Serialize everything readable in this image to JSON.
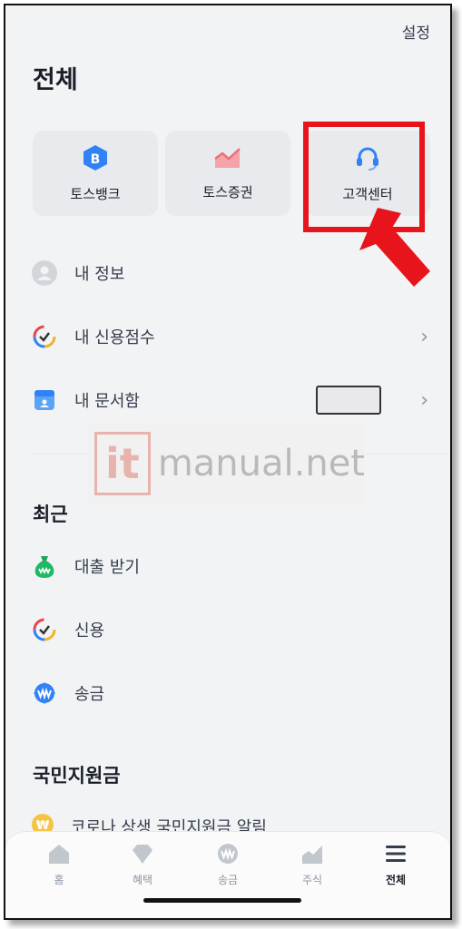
{
  "header": {
    "settings_label": "설정",
    "title": "전체"
  },
  "cards": [
    {
      "label": "토스뱅크",
      "icon": "toss-bank-icon"
    },
    {
      "label": "토스증권",
      "icon": "toss-securities-icon"
    },
    {
      "label": "고객센터",
      "icon": "headset-icon"
    }
  ],
  "menu": [
    {
      "label": "내 정보",
      "icon": "person-icon"
    },
    {
      "label": "내 신용점수",
      "icon": "credit-score-icon"
    },
    {
      "label": "내 문서함",
      "icon": "document-box-icon"
    }
  ],
  "watermark": {
    "mark": "it",
    "text": "manual.net"
  },
  "recent": {
    "title": "최근",
    "items": [
      {
        "label": "대출 받기",
        "icon": "money-bag-icon"
      },
      {
        "label": "신용",
        "icon": "credit-score-icon"
      },
      {
        "label": "송금",
        "icon": "transfer-icon"
      }
    ]
  },
  "support": {
    "title": "국민지원금",
    "items": [
      {
        "label": "코로나 상생 국민지원금 알림",
        "icon": "coin-icon"
      }
    ]
  },
  "tabs": [
    {
      "label": "홈",
      "icon": "home-icon",
      "active": false
    },
    {
      "label": "혜택",
      "icon": "benefit-icon",
      "active": false
    },
    {
      "label": "송금",
      "icon": "transfer-icon",
      "active": false
    },
    {
      "label": "주식",
      "icon": "stock-icon",
      "active": false
    },
    {
      "label": "전체",
      "icon": "menu-icon",
      "active": true
    }
  ],
  "colors": {
    "accent_blue": "#3182f6",
    "highlight_red": "#e8141c",
    "background": "#f2f3f5"
  }
}
